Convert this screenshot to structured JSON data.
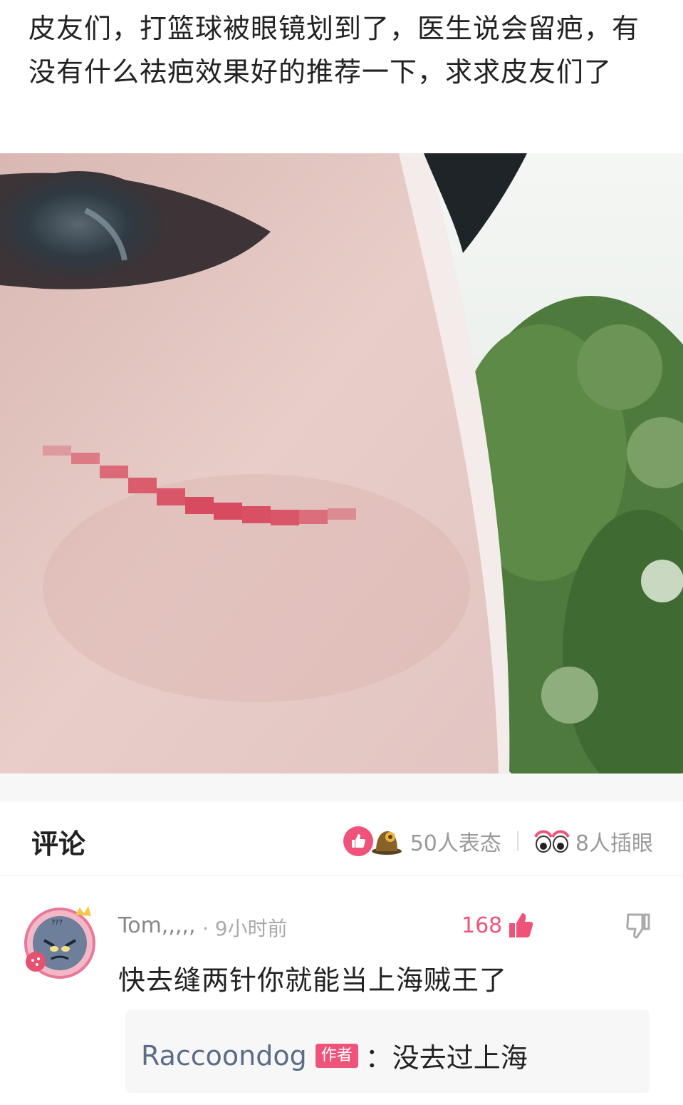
{
  "post": {
    "text": "皮友们，打篮球被眼镜划到了，医生说会留疤，有没有什么祛疤效果好的推荐一下，求求皮友们了"
  },
  "comments_section": {
    "title": "评论",
    "reactions_label": "50人表态",
    "peek_label": "8人插眼"
  },
  "comment": {
    "author": "Tom,,,,,",
    "time": "· 9小时前",
    "likes": "168",
    "text": "快去缝两针你就能当上海贼王了",
    "reply": {
      "author": "Raccoondog",
      "badge": "作者",
      "separator": "：",
      "text": "没去过上海"
    }
  },
  "colors": {
    "accent": "#f0537a",
    "reply_name": "#5b6b88"
  }
}
